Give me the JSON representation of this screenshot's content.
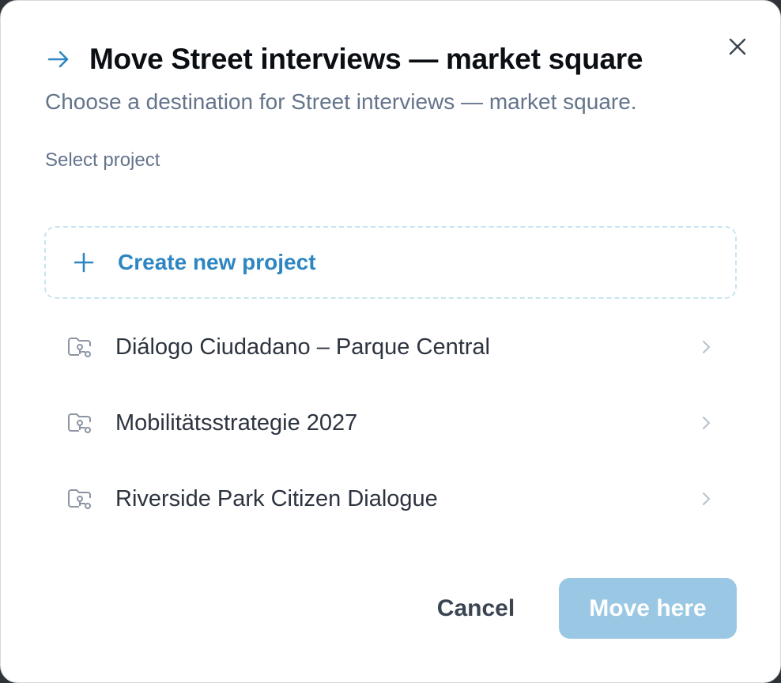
{
  "dialog": {
    "title": "Move Street interviews — market square",
    "subtitle": "Choose a destination for Street interviews — market square.",
    "section_label": "Select project",
    "create_label": "Create new project",
    "projects": [
      {
        "label": "Diálogo Ciudadano – Parque Central",
        "icon": "project-folder-icon"
      },
      {
        "label": "Mobilitätsstrategie 2027",
        "icon": "project-folder-icon"
      },
      {
        "label": "Riverside Park Citizen Dialogue",
        "icon": "project-folder-icon"
      }
    ],
    "cancel_label": "Cancel",
    "confirm_label": "Move here",
    "confirm_state": "disabled"
  },
  "icons": {
    "title": "arrow-right-icon",
    "close": "close-icon",
    "create": "plus-icon",
    "row_end": "chevron-right-icon"
  },
  "colors": {
    "accent": "#2d86c1",
    "confirm_disabled_bg": "#9ac8e4",
    "muted_text": "#64748b",
    "title_text": "#0b0f14"
  }
}
